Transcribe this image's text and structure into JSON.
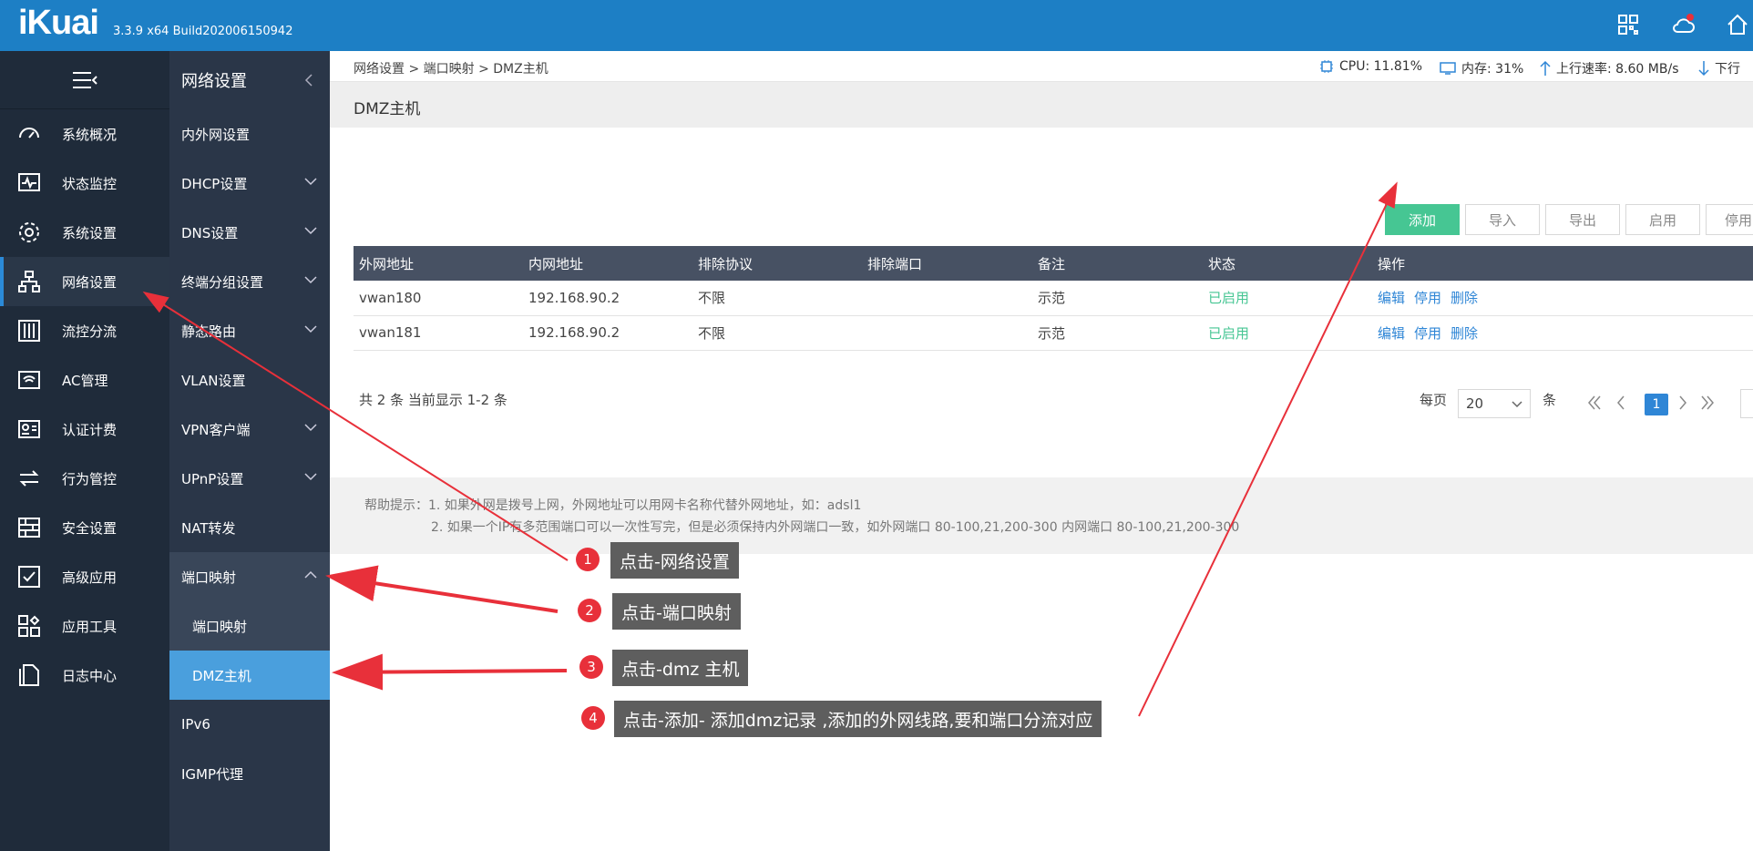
{
  "brand": {
    "logo": "iKuai",
    "version": "3.3.9 x64 Build202006150942"
  },
  "top_icons": [
    "apps-grid-icon",
    "cloud-icon",
    "home-icon"
  ],
  "sidebar": {
    "items": [
      {
        "label": "系统概况",
        "icon": "dashboard-icon"
      },
      {
        "label": "状态监控",
        "icon": "monitor-icon"
      },
      {
        "label": "系统设置",
        "icon": "gear-icon"
      },
      {
        "label": "网络设置",
        "icon": "network-icon"
      },
      {
        "label": "流控分流",
        "icon": "sliders-icon"
      },
      {
        "label": "AC管理",
        "icon": "wifi-icon"
      },
      {
        "label": "认证计费",
        "icon": "id-card-icon"
      },
      {
        "label": "行为管控",
        "icon": "arrows-icon"
      },
      {
        "label": "安全设置",
        "icon": "firewall-icon"
      },
      {
        "label": "高级应用",
        "icon": "checkbox-icon"
      },
      {
        "label": "应用工具",
        "icon": "tools-icon"
      },
      {
        "label": "日志中心",
        "icon": "log-icon"
      }
    ]
  },
  "subnav": {
    "title": "网络设置",
    "items": [
      {
        "label": "内外网设置"
      },
      {
        "label": "DHCP设置"
      },
      {
        "label": "DNS设置"
      },
      {
        "label": "终端分组设置"
      },
      {
        "label": "静态路由"
      },
      {
        "label": "VLAN设置"
      },
      {
        "label": "VPN客户端"
      },
      {
        "label": "UPnP设置"
      },
      {
        "label": "NAT转发"
      },
      {
        "label": "端口映射"
      },
      {
        "label": "端口映射"
      },
      {
        "label": "DMZ主机"
      },
      {
        "label": "IPv6"
      },
      {
        "label": "IGMP代理"
      }
    ]
  },
  "breadcrumb": {
    "a": "网络设置",
    "b": "端口映射",
    "c": "DMZ主机",
    "sep": ">"
  },
  "stats": {
    "cpu": "CPU: 11.81%",
    "mem": "内存: 31%",
    "up": "上行速率: 8.60 MB/s",
    "down": "下行"
  },
  "page_title": "DMZ主机",
  "toolbar": {
    "add": "添加",
    "import": "导入",
    "export": "导出",
    "enable": "启用",
    "disable": "停用"
  },
  "table": {
    "headers": [
      "外网地址",
      "内网地址",
      "排除协议",
      "排除端口",
      "备注",
      "状态",
      "操作"
    ],
    "rows": [
      {
        "wan": "vwan180",
        "lan": "192.168.90.2",
        "proto": "不限",
        "ports": "",
        "note": "示范",
        "status": "已启用"
      },
      {
        "wan": "vwan181",
        "lan": "192.168.90.2",
        "proto": "不限",
        "ports": "",
        "note": "示范",
        "status": "已启用"
      }
    ],
    "actions": {
      "edit": "编辑",
      "disable": "停用",
      "delete": "删除"
    }
  },
  "pagination": {
    "summary": "共 2 条 当前显示 1-2 条",
    "per_page_label": "每页",
    "per_page": "20",
    "unit": "条",
    "current": "1"
  },
  "help": {
    "line1": "帮助提示：1. 如果外网是拨号上网，外网地址可以用网卡名称代替外网地址，如：adsl1",
    "line2": "2. 如果一个IP有多范围端口可以一次性写完，但是必须保持内外网端口一致，如外网端口 80-100,21,200-300 内网端口 80-100,21,200-300"
  },
  "annotations": [
    {
      "num": "1",
      "text": "点击-网络设置"
    },
    {
      "num": "2",
      "text": "点击-端口映射"
    },
    {
      "num": "3",
      "text": "点击-dmz 主机"
    },
    {
      "num": "4",
      "text": "点击-添加- 添加dmz记录 ,添加的外网线路,要和端口分流对应"
    }
  ],
  "colors": {
    "topbar": "#1d7fc5",
    "sidebar": "#1f2b3a",
    "subnav": "#2a3648",
    "selected": "#4a9fdd",
    "primary": "#46c693",
    "arrow": "#e8303a"
  }
}
